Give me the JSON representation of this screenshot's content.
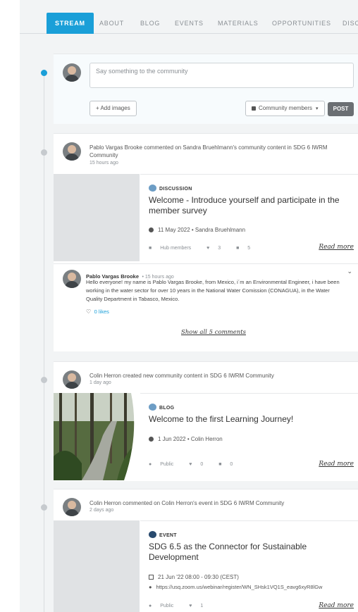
{
  "tabs": [
    {
      "label": "STREAM",
      "active": true
    },
    {
      "label": "ABOUT"
    },
    {
      "label": "BLOG"
    },
    {
      "label": "EVENTS"
    },
    {
      "label": "MATERIALS"
    },
    {
      "label": "OPPORTUNITIES"
    },
    {
      "label": "DISC"
    }
  ],
  "composer": {
    "placeholder": "Say something to the community",
    "add_images": "+ Add images",
    "visibility": "Community members",
    "post": "POST"
  },
  "feed": [
    {
      "activity": "Pablo Vargas Brooke commented on Sandra Bruehlmann's community content in SDG 6 IWRM Community",
      "time": "15 hours ago",
      "content_type": "DISCUSSION",
      "title": "Welcome - Introduce yourself and participate in the member survey",
      "meta": "11 May 2022 • Sandra Bruehlmann",
      "visibility": "Hub members",
      "likes": "3",
      "comments": "5",
      "read_more": "Read more",
      "comment": {
        "author": "Pablo Vargas Brooke",
        "time": "• 15 hours ago",
        "text": "Hello everyone! my name is Pablo Vargas Brooke, from Mexico, i´m an Environmental Engineer, i have been working in the water sector for over 10 years in the National Water Comission (CONAGUA), in the Water Quality Department in Tabasco, Mexico.",
        "likes": "0 likes"
      },
      "show_all": "Show all 5 comments"
    },
    {
      "activity": "Colin Herron created new community content in SDG 6 IWRM Community",
      "time": "1 day ago",
      "content_type": "BLOG",
      "title": "Welcome to the first Learning Journey!",
      "meta": "1 Jun 2022 • Colin Herron",
      "visibility": "Public",
      "likes": "0",
      "comments": "0",
      "read_more": "Read more"
    },
    {
      "activity": "Colin Herron commented on Colin Herron's event in SDG 6 IWRM Community",
      "time": "2 days ago",
      "content_type": "EVENT",
      "title": "SDG 6.5 as the Connector for Sustainable Development",
      "date": "21 Jun '22 08:00 - 09:30 (CEST)",
      "url": "https://usq.zoom.us/webinar/register/WN_SHsk1VQ1S_eavg6xyR8lGw",
      "visibility": "Public",
      "likes": "1",
      "read_more": "Read more"
    }
  ],
  "colors": {
    "accent": "#1a9fd8",
    "post_button": "#6b6f73",
    "blob_light": "#6d9dc5",
    "blob_dark": "#284a6e"
  }
}
